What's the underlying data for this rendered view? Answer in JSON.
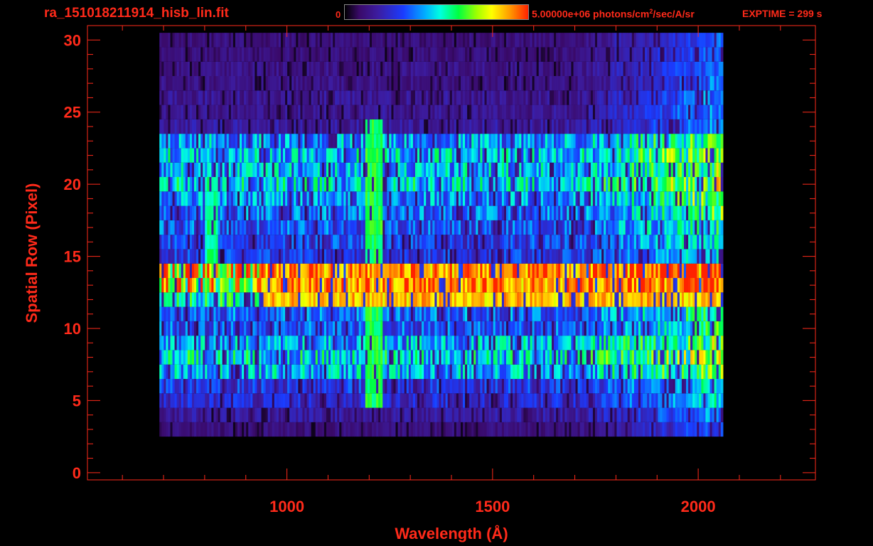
{
  "header": {
    "title": "ra_151018211914_hisb_lin.fit",
    "colorbar_min": "0",
    "colorbar_max_prefix": "5.00000e+06 photons/cm",
    "colorbar_max_sup": "2",
    "colorbar_max_suffix": "/sec/A/sr",
    "exptime": "EXPTIME = 299 s"
  },
  "colors": {
    "axis": "#ff2a1a",
    "background": "#000000"
  },
  "chart_data": {
    "type": "heatmap",
    "title": "ra_151018211914_hisb_lin.fit",
    "xlabel": "Wavelength (Å)",
    "ylabel": "Spatial Row (Pixel)",
    "xlim": [
      515,
      2285
    ],
    "ylim": [
      -0.5,
      31
    ],
    "x_ticks": [
      1000,
      1500,
      2000
    ],
    "y_ticks": [
      0,
      5,
      10,
      15,
      20,
      25,
      30
    ],
    "colorbar_range": [
      0,
      5000000
    ],
    "colorbar_units": "photons/cm²/sec/A/sr",
    "colormap": "rainbow",
    "grid": false,
    "row_profile": {
      "rows": [
        3,
        4,
        5,
        6,
        7,
        8,
        9,
        10,
        11,
        12,
        13,
        14,
        15,
        16,
        17,
        18,
        19,
        20,
        21,
        22,
        23,
        24,
        25,
        26,
        27,
        28,
        29,
        30
      ],
      "relative_intensity": [
        0.12,
        0.18,
        0.26,
        0.3,
        0.46,
        0.52,
        0.46,
        0.36,
        0.38,
        0.55,
        0.85,
        0.9,
        0.3,
        0.32,
        0.36,
        0.38,
        0.42,
        0.5,
        0.46,
        0.48,
        0.44,
        0.18,
        0.16,
        0.16,
        0.14,
        0.14,
        0.12,
        0.12
      ]
    },
    "features": [
      {
        "x_range": [
          930,
          2090
        ],
        "y_range": [
          12,
          14
        ],
        "relative_intensity": 0.9
      },
      {
        "x_range": [
          1190,
          1230
        ],
        "y_range": [
          5,
          24
        ],
        "relative_intensity": 0.65
      },
      {
        "x_range": [
          800,
          830
        ],
        "y_range": [
          14,
          20
        ],
        "relative_intensity": 0.6
      }
    ]
  }
}
